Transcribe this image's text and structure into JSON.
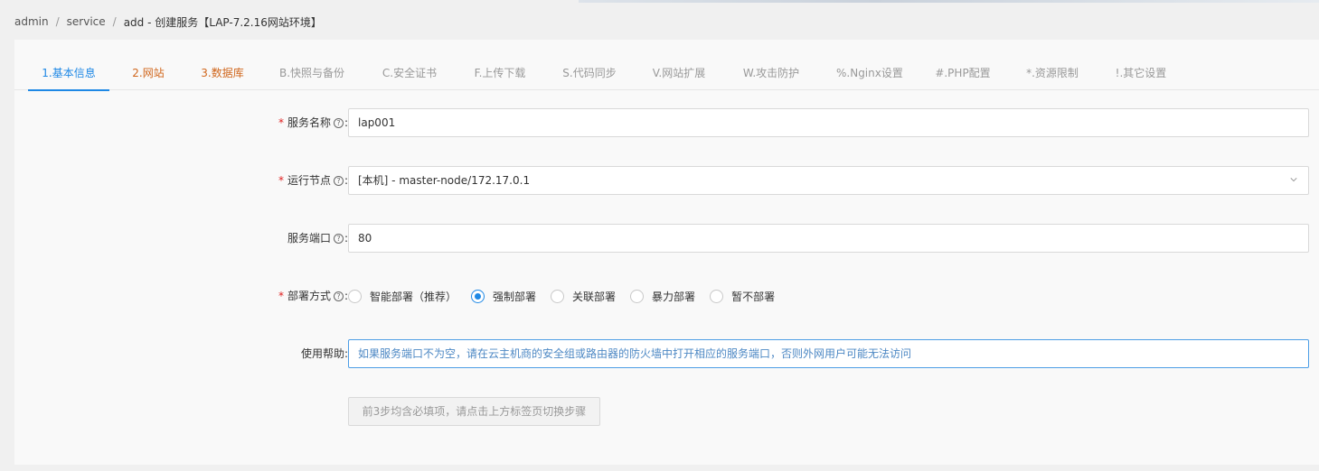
{
  "breadcrumb": {
    "items": [
      "admin",
      "service"
    ],
    "current": "add - 创建服务【LAP-7.2.16网站环境】"
  },
  "tabs": [
    {
      "label": "1.基本信息",
      "state": "active"
    },
    {
      "label": "2.网站",
      "state": "required"
    },
    {
      "label": "3.数据库",
      "state": "required"
    },
    {
      "label": "B.快照与备份",
      "state": "normal"
    },
    {
      "label": "C.安全证书",
      "state": "normal"
    },
    {
      "label": "F.上传下载",
      "state": "normal"
    },
    {
      "label": "S.代码同步",
      "state": "normal"
    },
    {
      "label": "V.网站扩展",
      "state": "normal"
    },
    {
      "label": "W.攻击防护",
      "state": "normal"
    },
    {
      "label": "%.Nginx设置",
      "state": "normal"
    },
    {
      "label": "#.PHP配置",
      "state": "normal"
    },
    {
      "label": "*.资源限制",
      "state": "normal"
    },
    {
      "label": "!.其它设置",
      "state": "normal"
    }
  ],
  "form": {
    "service_name": {
      "label": "服务名称",
      "required": true,
      "value": "lap001"
    },
    "run_node": {
      "label": "运行节点",
      "required": true,
      "value": "[本机] - master-node/172.17.0.1"
    },
    "service_port": {
      "label": "服务端口",
      "required": false,
      "value": "80"
    },
    "deploy_mode": {
      "label": "部署方式",
      "required": true,
      "options": [
        "智能部署（推荐）",
        "强制部署",
        "关联部署",
        "暴力部署",
        "暂不部署"
      ],
      "selected": "强制部署"
    },
    "help": {
      "label": "使用帮助:",
      "text": "如果服务端口不为空，请在云主机商的安全组或路由器的防火墙中打开相应的服务端口，否则外网用户可能无法访问"
    },
    "submit_label": "前3步均含必填项，请点击上方标签页切换步骤"
  },
  "icons": {
    "help": "question-circle-icon",
    "select": "chevron-down-icon"
  },
  "colors": {
    "accent": "#1e88e5",
    "required_tab": "#d0661c",
    "required_star": "#e02020"
  }
}
